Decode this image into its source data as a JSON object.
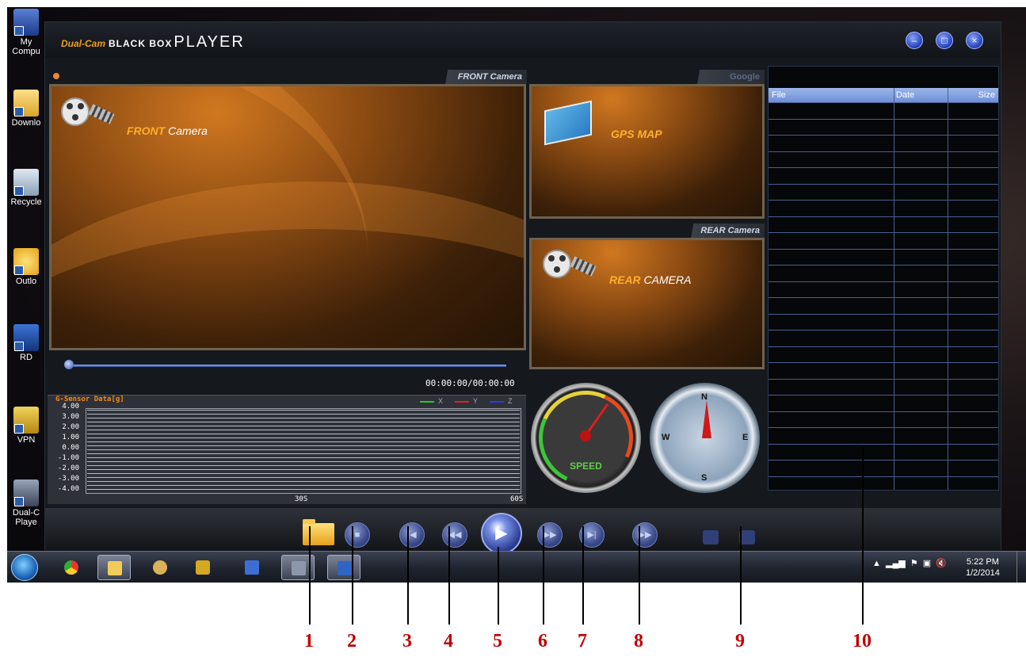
{
  "desktop": {
    "icons": [
      {
        "label": "My Compu",
        "icon": "computer-icon"
      },
      {
        "label": "Downlo",
        "icon": "downloads-folder-icon"
      },
      {
        "label": "Recycle",
        "icon": "recycle-bin-icon"
      },
      {
        "label": "Outlo",
        "icon": "outlook-icon"
      },
      {
        "label": "RD",
        "icon": "remote-desktop-icon"
      },
      {
        "label": "VPN",
        "icon": "vpn-lock-icon"
      },
      {
        "label": "Dual-C Playe",
        "icon": "player-shortcut-icon"
      }
    ]
  },
  "app": {
    "brand_part1": "Dual-Cam",
    "brand_part2": "BLACK BOX",
    "brand_part3": "PLAYER",
    "window_buttons": [
      "minimize-icon",
      "maximize-icon",
      "close-icon"
    ],
    "front_tab": "FRONT Camera",
    "front_label_bold": "FRONT",
    "front_label_rest": " Camera",
    "map_tab": "Google",
    "map_label": "GPS  MAP",
    "rear_tab": "REAR Camera",
    "rear_label_bold": "REAR",
    "rear_label_rest": " CAMERA",
    "timecode": "00:00:00/00:00:00",
    "seek_progress": 0,
    "gsensor": {
      "title": "G-Sensor Data[g]",
      "y_ticks": [
        "4.00",
        "3.00",
        "2.00",
        "1.00",
        "0.00",
        "-1.00",
        "-2.00",
        "-3.00",
        "-4.00"
      ],
      "x_ticks": [
        "30S",
        "60S"
      ],
      "legend": [
        {
          "label": "X",
          "color": "#22cc22"
        },
        {
          "label": "Y",
          "color": "#e02020"
        },
        {
          "label": "Z",
          "color": "#2040e0"
        }
      ]
    },
    "speed_label": "SPEED",
    "compass": {
      "n": "N",
      "s": "S",
      "e": "E",
      "w": "W"
    },
    "filelist": {
      "columns": [
        "File",
        "Date",
        "Size"
      ],
      "rows": []
    },
    "controls": [
      {
        "id": "open-folder",
        "icon": "folder-icon"
      },
      {
        "id": "stop",
        "icon": "stop-icon"
      },
      {
        "id": "prev-file",
        "icon": "skip-back-icon"
      },
      {
        "id": "rewind",
        "icon": "rewind-icon"
      },
      {
        "id": "play",
        "icon": "play-icon"
      },
      {
        "id": "fast-forward",
        "icon": "fast-forward-icon"
      },
      {
        "id": "next-file",
        "icon": "skip-forward-icon"
      },
      {
        "id": "step-forward",
        "icon": "step-forward-icon"
      },
      {
        "id": "snapshot",
        "icon": "camera-icon"
      },
      {
        "id": "settings",
        "icon": "record-icon"
      }
    ]
  },
  "taskbar": {
    "clock_time": "5:22 PM",
    "clock_date": "1/2/2014",
    "apps": [
      "chrome-icon",
      "explorer-icon",
      "sync-icon",
      "lock-icon",
      "network-icon",
      "player-icon",
      "word-icon"
    ]
  },
  "callouts": [
    "1",
    "2",
    "3",
    "4",
    "5",
    "6",
    "7",
    "8",
    "9",
    "10"
  ],
  "colors": {
    "accent": "#f0a020",
    "callout": "#c00000",
    "button": "#3b4a8a"
  }
}
